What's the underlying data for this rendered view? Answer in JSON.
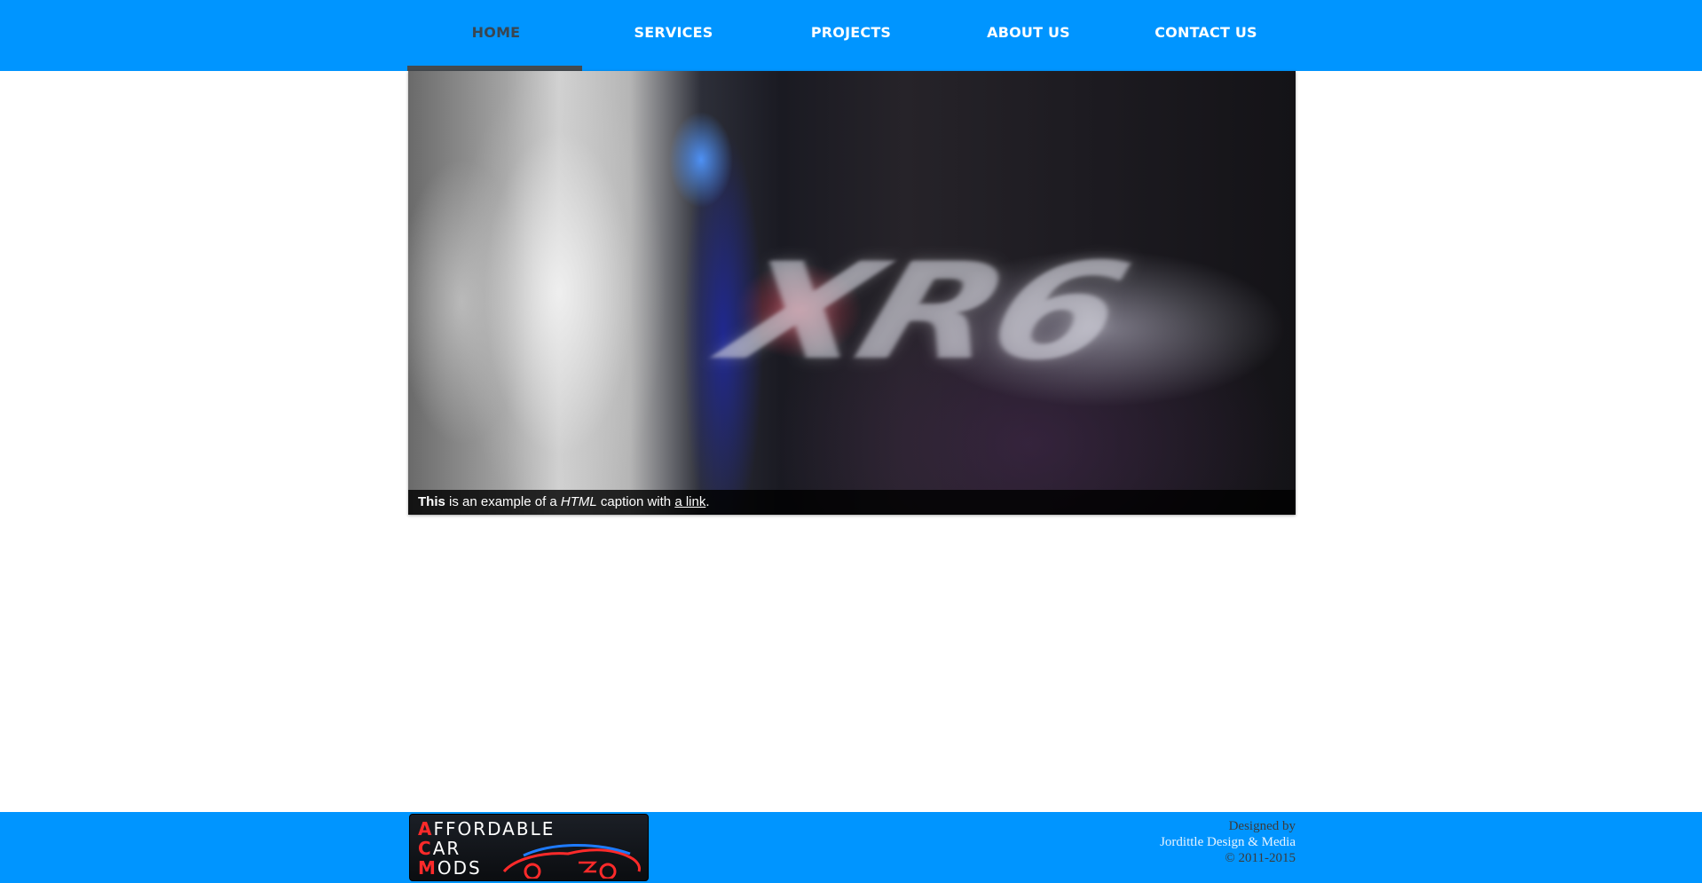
{
  "nav": {
    "items": [
      {
        "label": "HOME",
        "active": true
      },
      {
        "label": "SERVICES",
        "active": false
      },
      {
        "label": "PROJECTS",
        "active": false
      },
      {
        "label": "ABOUT US",
        "active": false
      },
      {
        "label": "CONTACT US",
        "active": false
      }
    ]
  },
  "slider": {
    "caption": {
      "bold": "This",
      "text1": " is an example of a ",
      "italic": "HTML",
      "text2": " caption with ",
      "link": "a link",
      "end": "."
    },
    "image_text": "XR6"
  },
  "footer": {
    "logo": {
      "line1_first": "A",
      "line1_rest": "FFORDABLE",
      "line2_first": "C",
      "line2_rest": "AR",
      "line3_first": "M",
      "line3_rest": "ODS"
    },
    "credits": {
      "line1": "Designed by",
      "line2": "Jordittle Design & Media",
      "line3": "© 2011-2015"
    }
  },
  "colors": {
    "brand_blue": "#0095ff",
    "active_nav_text": "#3a4650",
    "active_nav_underline": "#444a4f",
    "logo_red": "#ff2a2a"
  }
}
